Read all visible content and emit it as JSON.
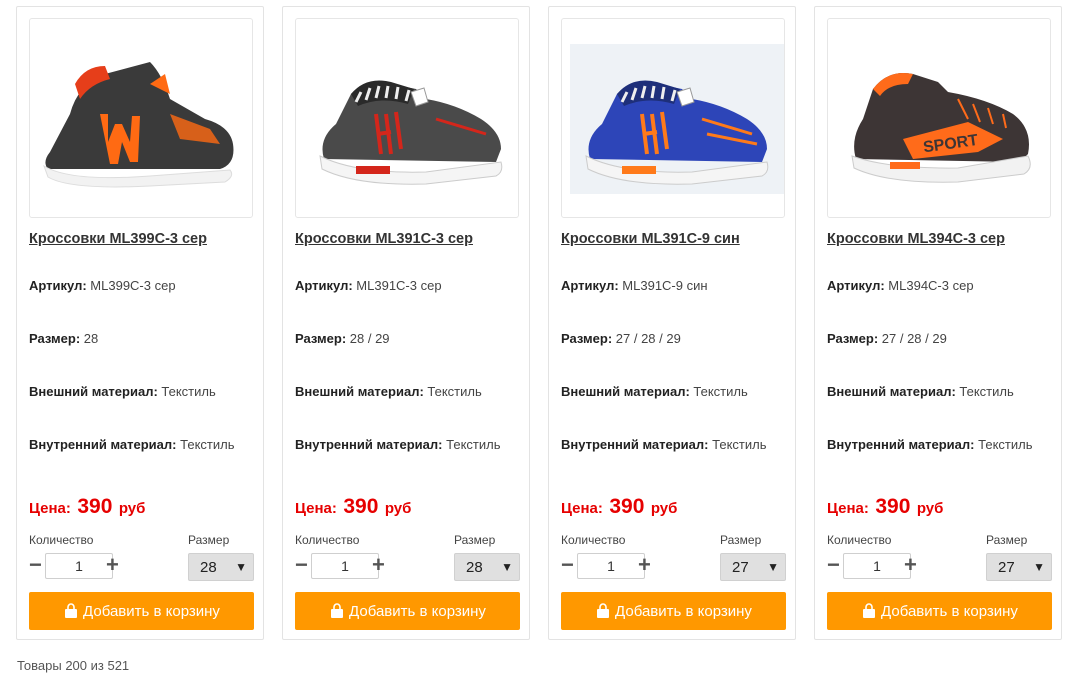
{
  "products": [
    {
      "title": "Кроссовки ML399C-3 сер",
      "article_label": "Артикул:",
      "article": "ML399C-3 сер",
      "size_label": "Размер:",
      "sizes": "28",
      "outer_label": "Внешний материал:",
      "outer": "Текстиль",
      "inner_label": "Внутренний материал:",
      "inner": "Текстиль",
      "price_label": "Цена:",
      "price": "390",
      "currency": "руб",
      "qty_label": "Количество",
      "qty": "1",
      "size_select_label": "Размер",
      "selected_size": "28",
      "add_label": "Добавить в корзину",
      "image_icon": "shoe-dark-orange-icon"
    },
    {
      "title": "Кроссовки ML391C-3 сер",
      "article_label": "Артикул:",
      "article": "ML391C-3 сер",
      "size_label": "Размер:",
      "sizes": "28 / 29",
      "outer_label": "Внешний материал:",
      "outer": "Текстиль",
      "inner_label": "Внутренний материал:",
      "inner": "Текстиль",
      "price_label": "Цена:",
      "price": "390",
      "currency": "руб",
      "qty_label": "Количество",
      "qty": "1",
      "size_select_label": "Размер",
      "selected_size": "28",
      "add_label": "Добавить в корзину",
      "image_icon": "shoe-gray-red-icon"
    },
    {
      "title": "Кроссовки ML391C-9 син",
      "article_label": "Артикул:",
      "article": "ML391C-9 син",
      "size_label": "Размер:",
      "sizes": "27 / 28 / 29",
      "outer_label": "Внешний материал:",
      "outer": "Текстиль",
      "inner_label": "Внутренний материал:",
      "inner": "Текстиль",
      "price_label": "Цена:",
      "price": "390",
      "currency": "руб",
      "qty_label": "Количество",
      "qty": "1",
      "size_select_label": "Размер",
      "selected_size": "27",
      "add_label": "Добавить в корзину",
      "image_icon": "shoe-blue-orange-icon"
    },
    {
      "title": "Кроссовки ML394C-3 сер",
      "article_label": "Артикул:",
      "article": "ML394C-3 сер",
      "size_label": "Размер:",
      "sizes": "27 / 28 / 29",
      "outer_label": "Внешний материал:",
      "outer": "Текстиль",
      "inner_label": "Внутренний материал:",
      "inner": "Текстиль",
      "price_label": "Цена:",
      "price": "390",
      "currency": "руб",
      "qty_label": "Количество",
      "qty": "1",
      "size_select_label": "Размер",
      "selected_size": "27",
      "add_label": "Добавить в корзину",
      "image_icon": "shoe-dark-sport-icon"
    }
  ],
  "footer": {
    "count_text": "Товары 200 из 521"
  },
  "colors": {
    "price": "#e60000",
    "button": "#ff9800",
    "select_bg": "#e0e0e0"
  }
}
